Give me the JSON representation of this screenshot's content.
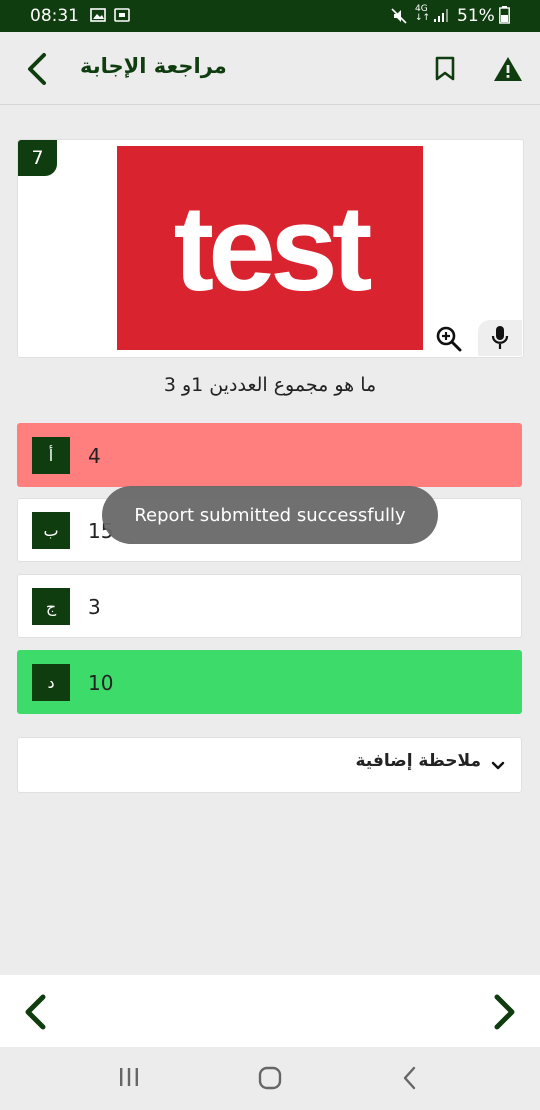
{
  "status_bar": {
    "time": "08:31",
    "battery": "51%"
  },
  "header": {
    "title": "مراجعة الإجابة",
    "icons": [
      "chevron-left-icon",
      "bookmark-icon",
      "warning-icon"
    ]
  },
  "question": {
    "number": "7",
    "image_text": "test",
    "text": "ما هو مجموع العددين 1و 3"
  },
  "options": [
    {
      "letter": "أ",
      "value": "4",
      "state": "wrong",
      "color": "#ff7f7f"
    },
    {
      "letter": "ب",
      "value": "15",
      "state": "neutral",
      "color": "#ffffff"
    },
    {
      "letter": "ج",
      "value": "3",
      "state": "neutral",
      "color": "#ffffff"
    },
    {
      "letter": "د",
      "value": "10",
      "state": "correct",
      "color": "#3ddc6a"
    }
  ],
  "note": {
    "label": "ملاحظة إضافية"
  },
  "toast": {
    "message": "Report submitted successfully"
  },
  "colors": {
    "primary": "#0f3d0f",
    "wrong": "#ff7f7f",
    "correct": "#3ddc6a",
    "image_bg": "#d9232e"
  }
}
